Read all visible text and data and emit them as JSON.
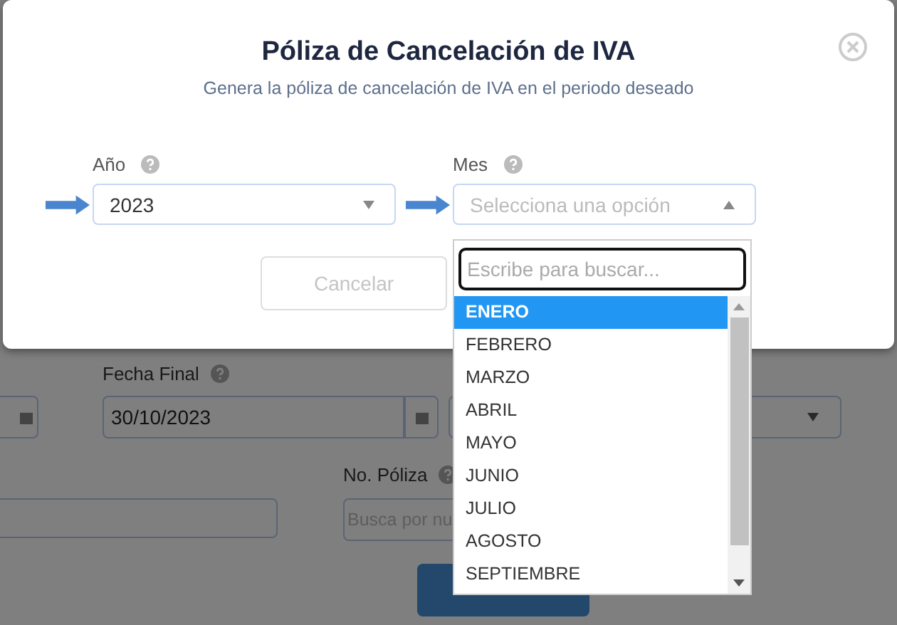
{
  "background": {
    "fecha_final": {
      "label": "Fecha Final",
      "value": "30/10/2023"
    },
    "no_poliza": {
      "label": "No. Póliza",
      "placeholder": "Busca por nu"
    }
  },
  "modal": {
    "title": "Póliza de Cancelación de IVA",
    "subtitle": "Genera la póliza de cancelación de IVA en el periodo deseado",
    "fields": [
      {
        "label": "Año",
        "value": "2023",
        "open": false
      },
      {
        "label": "Mes",
        "placeholder": "Selecciona una opción",
        "open": true
      }
    ],
    "cancel_button": {
      "label": "Cancelar",
      "disabled": true
    }
  },
  "dropdown": {
    "search": {
      "placeholder": "Escribe para buscar..."
    },
    "options": [
      {
        "label": "ENERO",
        "selected": true
      },
      {
        "label": "FEBRERO",
        "selected": false
      },
      {
        "label": "MARZO",
        "selected": false
      },
      {
        "label": "ABRIL",
        "selected": false
      },
      {
        "label": "MAYO",
        "selected": false
      },
      {
        "label": "JUNIO",
        "selected": false
      },
      {
        "label": "JULIO",
        "selected": false
      },
      {
        "label": "AGOSTO",
        "selected": false
      },
      {
        "label": "SEPTIEMBRE",
        "selected": false
      }
    ]
  }
}
